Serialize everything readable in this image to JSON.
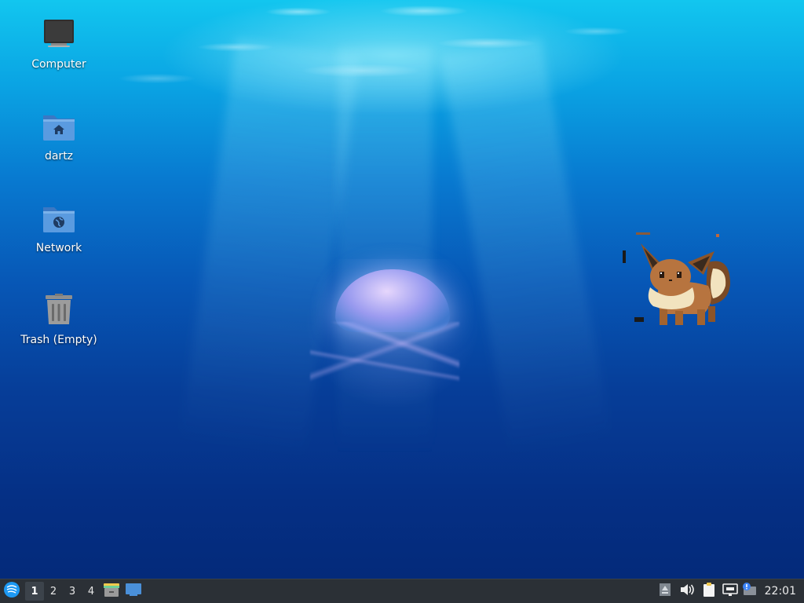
{
  "desktop": {
    "icons": [
      {
        "label": "Computer",
        "icon": "computer-icon"
      },
      {
        "label": "dartz",
        "icon": "home-folder-icon"
      },
      {
        "label": "Network",
        "icon": "network-folder-icon"
      },
      {
        "label": "Trash (Empty)",
        "icon": "trash-icon"
      }
    ],
    "widget": {
      "icon": "eevee-sprite-icon"
    }
  },
  "taskbar": {
    "start_icon": "start-menu-icon",
    "workspaces": [
      {
        "label": "1",
        "active": true
      },
      {
        "label": "2",
        "active": false
      },
      {
        "label": "3",
        "active": false
      },
      {
        "label": "4",
        "active": false
      }
    ],
    "launchers": [
      "file-manager-icon",
      "show-desktop-icon"
    ],
    "tray": [
      "tray-arrow-icon",
      "volume-icon",
      "clipboard-icon",
      "network-icon",
      "update-notifier-icon"
    ],
    "clock": "22:01"
  },
  "colors": {
    "taskbar_bg": "#2b3036",
    "folder_blue": "#4a90d9",
    "accent": "#1d99f3"
  }
}
